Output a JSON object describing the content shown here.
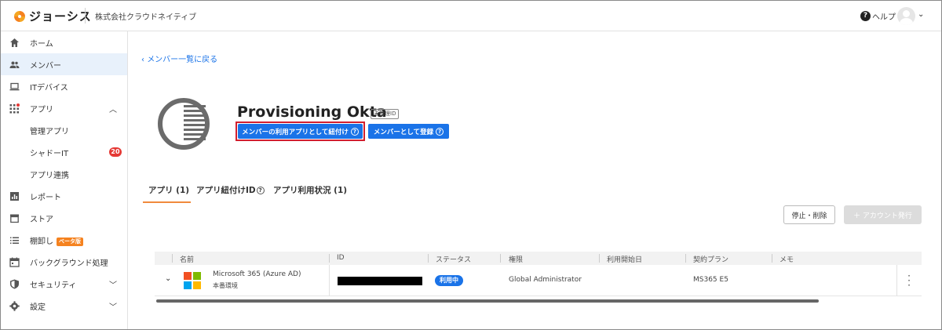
{
  "header": {
    "brand": "ジョーシス",
    "company": "株式会社クラウドネイティブ",
    "help_label": "ヘルプ"
  },
  "sidebar": {
    "items": [
      {
        "label": "ホーム"
      },
      {
        "label": "メンバー"
      },
      {
        "label": "ITデバイス"
      },
      {
        "label": "アプリ"
      },
      {
        "label": "管理アプリ"
      },
      {
        "label": "シャドーIT",
        "badge": "20"
      },
      {
        "label": "アプリ連携"
      },
      {
        "label": "レポート"
      },
      {
        "label": "ストア"
      },
      {
        "label": "棚卸し",
        "badge": "ベータ版"
      },
      {
        "label": "バックグラウンド処理"
      },
      {
        "label": "セキュリティ"
      },
      {
        "label": "設定"
      }
    ]
  },
  "main": {
    "back_link": "メンバー一覧に戻る",
    "app_title": "Provisioning Okta",
    "unmanaged_tag": "未管理ID",
    "link_app_button": "メンバーの利用アプリとして紐付け",
    "register_button": "メンバーとして登録",
    "tabs": [
      {
        "label": "アプリ (1)"
      },
      {
        "label": "アプリ紐付けID"
      },
      {
        "label": "アプリ利用状況 (1)"
      }
    ],
    "stop_button": "停止・削除",
    "issue_button": "＋ アカウント発行",
    "table": {
      "headers": [
        "名前",
        "ID",
        "ステータス",
        "権限",
        "利用開始日",
        "契約プラン",
        "メモ"
      ],
      "rows": [
        {
          "name": "Microsoft 365 (Azure AD)",
          "env": "本番環境",
          "status": "利用中",
          "role": "Global Administrator",
          "start_date": "",
          "plan": "MS365 E5",
          "memo": ""
        }
      ]
    }
  },
  "colors": {
    "accent_blue": "#1a73e8",
    "highlight_red": "#d21f2f",
    "tab_orange": "#f08a3c",
    "badge_red": "#e53935",
    "beta_orange": "#f5821f"
  }
}
